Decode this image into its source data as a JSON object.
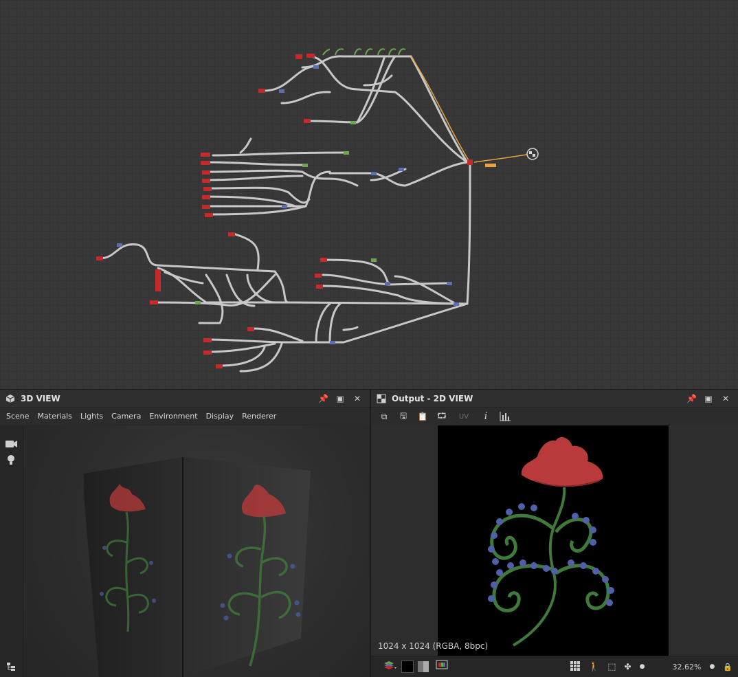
{
  "panel3d": {
    "title": "3D VIEW",
    "menus": [
      "Scene",
      "Materials",
      "Lights",
      "Camera",
      "Environment",
      "Display",
      "Renderer"
    ],
    "side_tools": [
      "camera-icon",
      "light-bulb-icon"
    ]
  },
  "panel2d": {
    "title": "Output - 2D VIEW",
    "toolbar": [
      "copy-icon",
      "save-icon",
      "clipboard-icon",
      "share-nodes-icon",
      "UV",
      "info-icon",
      "histogram-icon"
    ],
    "uv_label": "UV",
    "resolution": "1024 x 1024 (RGBA, 8bpc)",
    "zoom": "32.62%"
  },
  "title_buttons": [
    "pin-icon",
    "maximize-icon",
    "close-icon"
  ],
  "colors": {
    "accent_orange": "#e8a33d",
    "node_red": "#c42a2a",
    "node_blue": "#5b6fb8",
    "node_green": "#6aa84f",
    "flower_red": "#b93a3a",
    "stem_green": "#3f7a3a"
  }
}
